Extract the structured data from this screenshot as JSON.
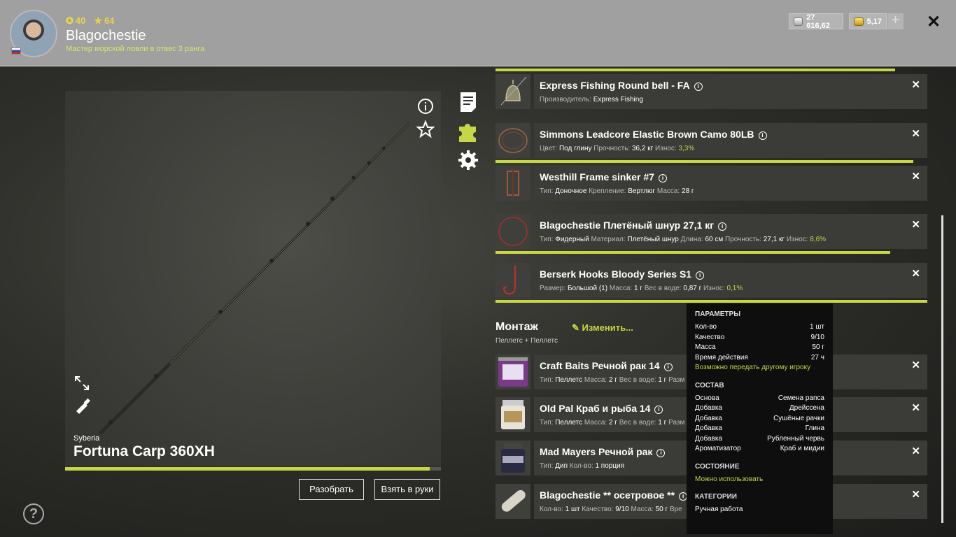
{
  "user": {
    "name": "Blagochestie",
    "rank": "Мастер морской ловли в отвес 3 ранга",
    "level": "40",
    "stars": "64"
  },
  "currency": {
    "silver": "27 616,62",
    "gold": "5,17"
  },
  "rod": {
    "brand": "Syberia",
    "name": "Fortuna Carp 360XH",
    "durability": 0.97,
    "disassemble_label": "Разобрать",
    "equip_label": "Взять в руки"
  },
  "components": [
    {
      "title": "Express Fishing Round bell - FA",
      "meta": [
        [
          "Производитель:",
          "Express Fishing",
          ""
        ]
      ]
    },
    {
      "title": "Simmons Leadcore Elastic Brown Camo 80LB",
      "meta": [
        [
          "Цвет:",
          "Под глину",
          ""
        ],
        [
          "Прочность:",
          "36,2 кг",
          ""
        ],
        [
          "Износ:",
          "",
          "3,3%"
        ]
      ]
    },
    {
      "title": "Westhill Frame sinker #7",
      "meta": [
        [
          "Тип:",
          "Доночное",
          ""
        ],
        [
          "Крепление:",
          "Вертлюг",
          ""
        ],
        [
          "Масса:",
          "28 г",
          ""
        ]
      ]
    },
    {
      "title": "Blagochestie Плетёный шнур 27,1 кг",
      "meta": [
        [
          "Тип:",
          "Фидерный",
          ""
        ],
        [
          "Материал:",
          "Плетёный шнур",
          ""
        ],
        [
          "Длина:",
          "60 см",
          ""
        ],
        [
          "Прочность:",
          "27,1 кг",
          ""
        ],
        [
          "Износ:",
          "",
          "8,6%"
        ]
      ]
    },
    {
      "title": "Berserk Hooks Bloody Series S1",
      "meta": [
        [
          "Размер:",
          "Большой (1)",
          ""
        ],
        [
          "Масса:",
          "1 г",
          ""
        ],
        [
          "Вес в воде:",
          "0,87 г",
          ""
        ],
        [
          "Износ:",
          "",
          "0,1%"
        ]
      ]
    }
  ],
  "montage": {
    "title": "Монтаж",
    "subtitle": "Пеллетс + Пеллетс",
    "edit_label": "Изменить..."
  },
  "baits": [
    {
      "title": "Craft Baits Речной рак 14",
      "meta": [
        [
          "Тип:",
          "Пеллетс",
          ""
        ],
        [
          "Масса:",
          "2 г",
          ""
        ],
        [
          "Вес в воде:",
          "1 г",
          ""
        ],
        [
          "Разм",
          "",
          ""
        ]
      ]
    },
    {
      "title": "Old Pal Краб и рыба 14",
      "meta": [
        [
          "Тип:",
          "Пеллетс",
          ""
        ],
        [
          "Масса:",
          "2 г",
          ""
        ],
        [
          "Вес в воде:",
          "1 г",
          ""
        ],
        [
          "Разм",
          "",
          ""
        ]
      ]
    },
    {
      "title": "Mad Mayers Речной рак",
      "meta": [
        [
          "Тип:",
          "Дип",
          ""
        ],
        [
          "Кол-во:",
          "1 порция",
          ""
        ]
      ]
    },
    {
      "title": "Blagochestie ** осетровое **",
      "meta": [
        [
          "Кол-во:",
          "1 шт",
          ""
        ],
        [
          "Качество:",
          "9/10",
          ""
        ],
        [
          "Масса:",
          "50 г",
          ""
        ],
        [
          "Вре",
          "",
          ""
        ]
      ]
    }
  ],
  "tooltip": {
    "params_title": "ПАРАМЕТРЫ",
    "params": [
      [
        "Кол-во",
        "1 шт"
      ],
      [
        "Качество",
        "9/10"
      ],
      [
        "Масса",
        "50 г"
      ],
      [
        "Время действия",
        "27 ч"
      ]
    ],
    "transfer_note": "Возможно передать другому игроку",
    "composition_title": "СОСТАВ",
    "composition": [
      [
        "Основа",
        "Семена рапса"
      ],
      [
        "Добавка",
        "Дрейссена"
      ],
      [
        "Добавка",
        "Сушёные рачки"
      ],
      [
        "Добавка",
        "Глина"
      ],
      [
        "Добавка",
        "Рубленный червь"
      ],
      [
        "Ароматизатор",
        "Краб и мидии"
      ]
    ],
    "state_title": "СОСТОЯНИЕ",
    "state_value": "Можно использовать",
    "categories_title": "КАТЕГОРИИ",
    "categories_value": "Ручная работа"
  },
  "colors": {
    "accent": "#c6d645",
    "header_bg": "#a0a0a0",
    "row_bg": "#3b3b38",
    "tooltip_bg": "#0e0e0e"
  }
}
